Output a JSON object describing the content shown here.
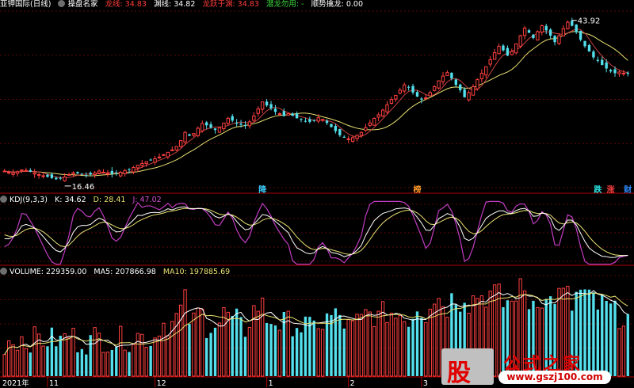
{
  "header": {
    "stock_name": "亚钾国际(日线)",
    "indicator_name": "操盘名家",
    "items": [
      {
        "label": "龙线:",
        "value": "34.83",
        "color": "#ff3b3b"
      },
      {
        "label": "渊线:",
        "value": "34.82",
        "color": "#ffffff"
      },
      {
        "label": "龙跃于渊:",
        "value": "34.83",
        "color": "#ff3b3b"
      },
      {
        "label": "潜龙勿用:",
        "value": "-",
        "color": "#3dd63d"
      },
      {
        "label": "顺势擒龙:",
        "value": "0.00",
        "color": "#ffffff"
      }
    ]
  },
  "kdj_header": {
    "name": "KDJ(9,3,3)",
    "k_label": "K:",
    "k_value": "34.62",
    "d_label": "D:",
    "d_value": "28.41",
    "j_label": "J:",
    "j_value": "47.02"
  },
  "volume_header": {
    "name": "VOLUME:",
    "value": "229359.00",
    "ma5_label": "MA5:",
    "ma5_value": "207866.98",
    "ma10_label": "MA10:",
    "ma10_value": "197885.69"
  },
  "price_labels": {
    "high": "43.92",
    "low": "16.46"
  },
  "signal_tags": [
    {
      "text": "降",
      "color": "#3ad0ff",
      "bar": 60
    },
    {
      "text": "榜",
      "color": "#ff9a2a",
      "bar": 96
    },
    {
      "text": "跌",
      "color": "#2be8e8",
      "bar": 138
    },
    {
      "text": "涨",
      "color": "#ff4040",
      "bar": 141
    },
    {
      "text": "财",
      "color": "#2b8bff",
      "bar": 145
    }
  ],
  "x_axis_labels": [
    {
      "text": "2021年",
      "bar": 0
    },
    {
      "text": "11",
      "bar": 10
    },
    {
      "text": "12",
      "bar": 35
    },
    {
      "text": "1",
      "bar": 61
    },
    {
      "text": "2",
      "bar": 80
    },
    {
      "text": "3",
      "bar": 97
    }
  ],
  "watermark": {
    "logo_char": "股",
    "title": "公式之家",
    "url": "www.gszj100.com"
  },
  "colors": {
    "up": "#ff4040",
    "down": "#53e0ec",
    "k_line": "#ffffff",
    "d_line": "#e8e070",
    "j_line": "#c03cc0",
    "ma_slow": "#e8e070",
    "ma_fast": "#c84040",
    "separator": "#b00000"
  },
  "chart_data": [
    {
      "type": "candlestick",
      "title": "亚钾国际(日线)",
      "x_type": "trading days, chronological, ~146 bars",
      "price_high": 43.92,
      "price_low": 16.46,
      "closes": [
        18.2,
        18.0,
        17.9,
        18.1,
        18.4,
        18.3,
        18.1,
        17.9,
        17.6,
        17.4,
        17.2,
        17.0,
        16.8,
        16.9,
        17.2,
        17.6,
        17.9,
        17.8,
        17.6,
        17.5,
        17.6,
        17.9,
        18.2,
        18.0,
        17.8,
        17.7,
        17.8,
        18.0,
        18.3,
        18.5,
        18.8,
        19.2,
        19.5,
        19.8,
        20.0,
        20.3,
        20.6,
        21.0,
        21.4,
        21.8,
        22.4,
        23.4,
        24.8,
        24.2,
        24.6,
        25.5,
        26.3,
        26.0,
        25.6,
        25.2,
        25.6,
        26.4,
        27.2,
        26.8,
        26.3,
        26.1,
        26.0,
        26.6,
        27.6,
        28.8,
        30.0,
        29.4,
        28.9,
        28.3,
        28.0,
        27.6,
        28.0,
        27.6,
        27.2,
        27.0,
        26.7,
        26.6,
        26.8,
        27.3,
        27.0,
        26.4,
        25.7,
        25.0,
        24.3,
        23.9,
        23.7,
        23.9,
        24.3,
        24.8,
        25.6,
        26.4,
        27.2,
        27.8,
        28.6,
        29.5,
        30.4,
        31.1,
        32.0,
        32.9,
        32.5,
        31.6,
        30.9,
        30.4,
        30.7,
        31.6,
        32.6,
        33.6,
        34.4,
        35.0,
        34.0,
        32.9,
        32.0,
        30.8,
        31.6,
        32.6,
        33.8,
        34.9,
        36.0,
        37.2,
        38.4,
        39.5,
        38.8,
        37.9,
        38.6,
        39.9,
        41.3,
        42.6,
        41.8,
        40.9,
        42.0,
        43.0,
        42.2,
        41.3,
        40.2,
        41.3,
        42.5,
        43.6,
        43.0,
        41.9,
        40.6,
        39.5,
        38.6,
        37.6,
        37.0,
        36.3,
        35.7,
        35.2,
        34.9,
        35.1,
        34.9,
        34.8
      ]
    },
    {
      "type": "line",
      "title": "KDJ(9,3,3)",
      "series": [
        {
          "name": "K",
          "last": 34.62
        },
        {
          "name": "D",
          "last": 28.41
        },
        {
          "name": "J",
          "last": 47.02
        }
      ]
    },
    {
      "type": "bar",
      "title": "VOLUME",
      "series": [
        {
          "name": "VOLUME",
          "last": 229359.0
        },
        {
          "name": "MA5",
          "last": 207866.98
        },
        {
          "name": "MA10",
          "last": 197885.69
        }
      ]
    }
  ]
}
